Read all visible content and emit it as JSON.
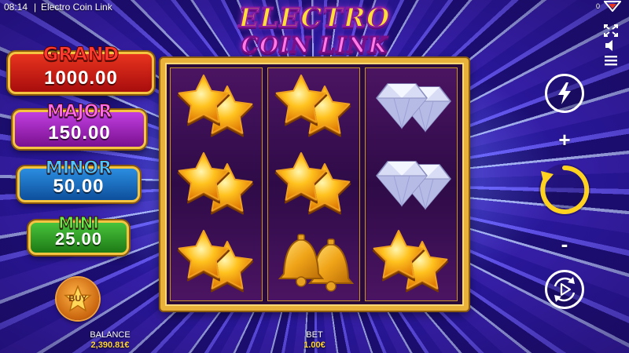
{
  "topbar": {
    "time": "08:14",
    "separator": "|",
    "title": "Electro Coin Link",
    "notification_count": "0"
  },
  "logo": {
    "line1": "ELECTRO",
    "line2": "COIN LINK"
  },
  "jackpots": [
    {
      "name": "GRAND",
      "amount": "1000.00"
    },
    {
      "name": "MAJOR",
      "amount": "150.00"
    },
    {
      "name": "MINOR",
      "amount": "50.00"
    },
    {
      "name": "MINI",
      "amount": "25.00"
    }
  ],
  "buy_button": {
    "label": "BUY"
  },
  "reels": [
    [
      "star",
      "star",
      "star"
    ],
    [
      "star",
      "star",
      "bell"
    ],
    [
      "diamond",
      "diamond",
      "star"
    ]
  ],
  "footer": {
    "balance_label": "BALANCE",
    "balance_value": "2,390.81€",
    "bet_label": "BET",
    "bet_value": "1.00€"
  },
  "controls": {
    "plus": "+",
    "minus": "-",
    "icons": [
      "fullscreen-icon",
      "sound-icon",
      "menu-icon",
      "turbo-icon",
      "spin-icon",
      "autoplay-icon"
    ]
  },
  "colors": {
    "grand": "#e8331e",
    "major": "#c03ee0",
    "minor": "#2b8de0",
    "mini": "#48c33c",
    "frame_gold": "#e8b23a",
    "spin_yellow": "#ffd21f"
  }
}
